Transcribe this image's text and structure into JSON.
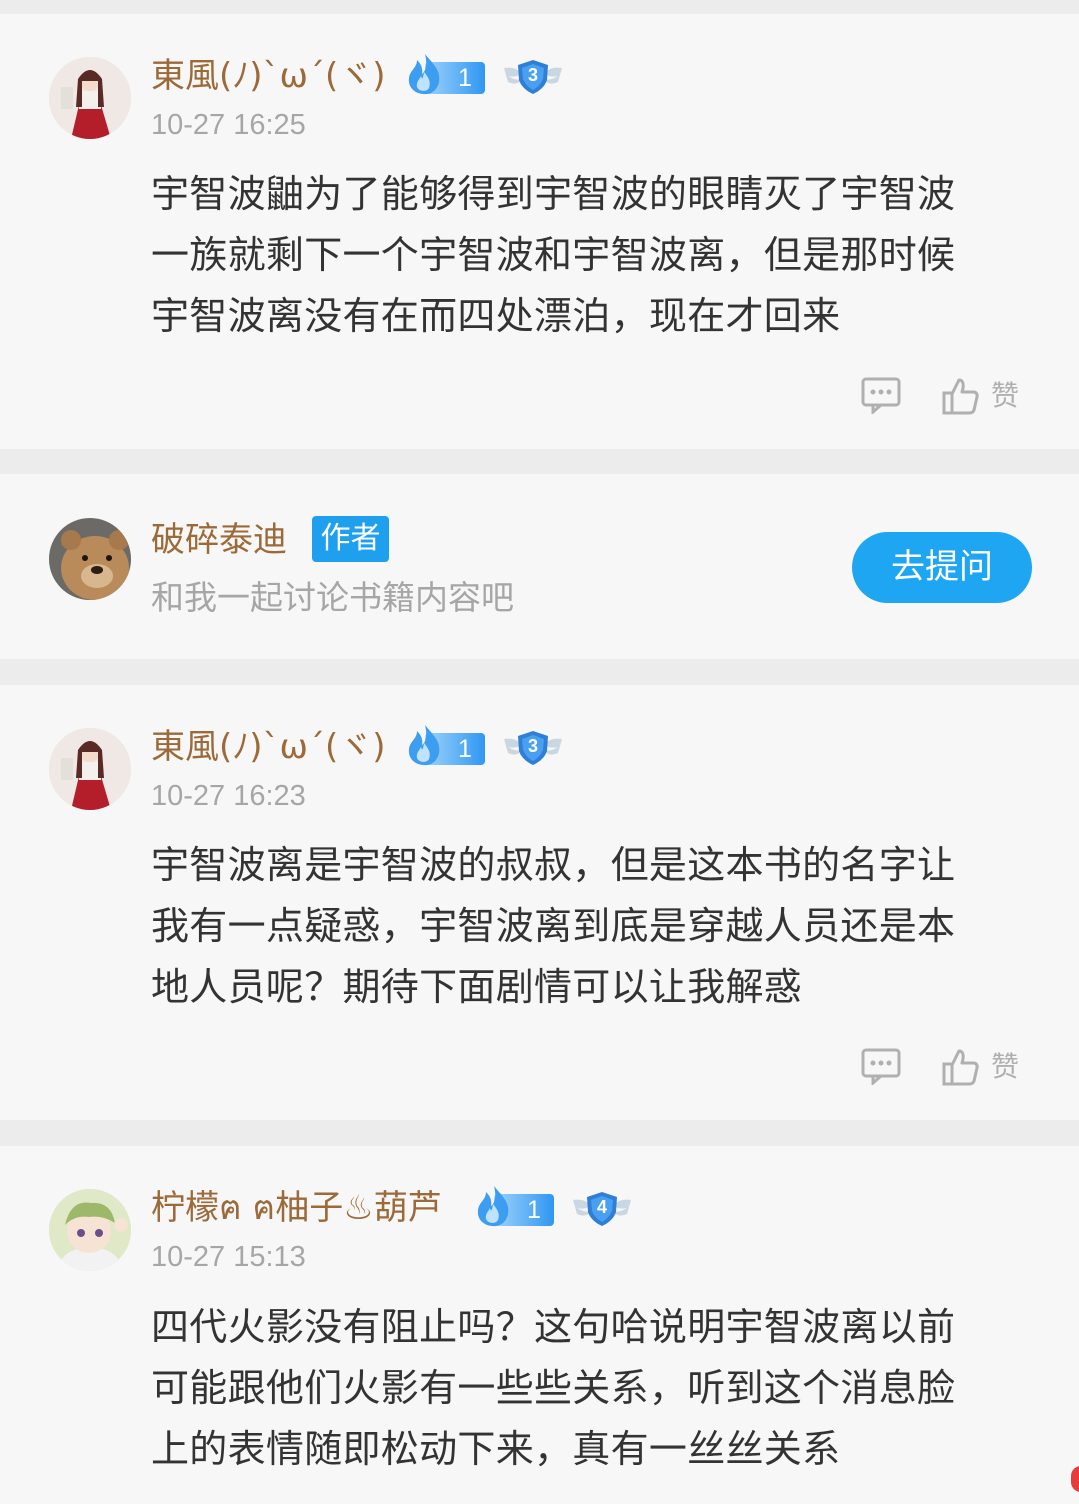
{
  "comments": [
    {
      "username": "東風(ﾉ)`ω´(ヾ)",
      "fire_level": "1",
      "shield_level": "3",
      "time": "10-27 16:25",
      "lines": [
        "宇智波鼬为了能够得到宇智波的眼睛灭了宇智波",
        "一族就剩下一个宇智波和宇智波离，但是那时候",
        "宇智波离没有在而四处漂泊，现在才回来"
      ],
      "like_label": "赞"
    },
    {
      "username": "東風(ﾉ)`ω´(ヾ)",
      "fire_level": "1",
      "shield_level": "3",
      "time": "10-27 16:23",
      "lines": [
        "宇智波离是宇智波的叔叔，但是这本书的名字让",
        "我有一点疑惑，宇智波离到底是穿越人员还是本",
        "地人员呢？期待下面剧情可以让我解惑"
      ],
      "like_label": "赞"
    },
    {
      "username": "柠檬ฅ ฅ柚子♨葫芦",
      "fire_level": "1",
      "shield_level": "4",
      "time": "10-27 15:13",
      "lines": [
        "四代火影没有阻止吗？这句哈说明宇智波离以前",
        "可能跟他们火影有一些些关系，听到这个消息脸",
        "上的表情随即松动下来，真有一丝丝关系"
      ]
    }
  ],
  "author_card": {
    "name": "破碎泰迪",
    "tag": "作者",
    "subtitle": "和我一起讨论书籍内容吧",
    "button": "去提问"
  },
  "colors": {
    "username": "#9c6a38",
    "accent_blue": "#1ea6f2",
    "background": "#f7f7f7",
    "separator": "#ececec"
  }
}
